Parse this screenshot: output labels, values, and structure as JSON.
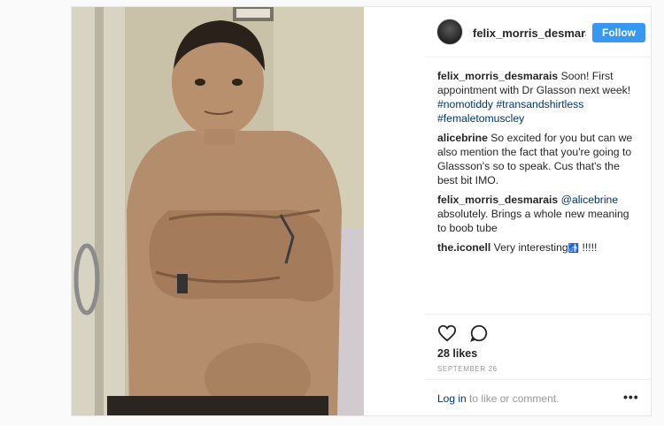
{
  "header": {
    "username": "felix_morris_desmarais",
    "follow_label": "Follow"
  },
  "comments": [
    {
      "user": "felix_morris_desmarais",
      "text": " Soon! First appointment with Dr Glasson next week! ",
      "tags": [
        "#nomotiddy",
        "#transandshirtless",
        "#femaletomuscley"
      ]
    },
    {
      "user": "alicebrine",
      "text": " So excited for you but can we also mention the fact that you're going to Glassson's so to speak. Cus that's the best bit IMO."
    },
    {
      "user": "felix_morris_desmarais",
      "mention": " @alicebrine",
      "text": " absolutely. Brings a whole new meaning to boob tube"
    },
    {
      "user": "the.iconell",
      "text": " Very interesting",
      "emoji": "🚮",
      "after": " !!!!!"
    }
  ],
  "actions": {
    "like_icon": "heart-icon",
    "comment_icon": "speech-bubble-icon",
    "likes": "28 likes",
    "date": "SEPTEMBER 26"
  },
  "footer": {
    "login_link": "Log in",
    "login_rest": " to like or comment.",
    "more": "•••"
  },
  "colors": {
    "follow": "#3897f0",
    "link": "#003569",
    "muted": "#999999"
  }
}
